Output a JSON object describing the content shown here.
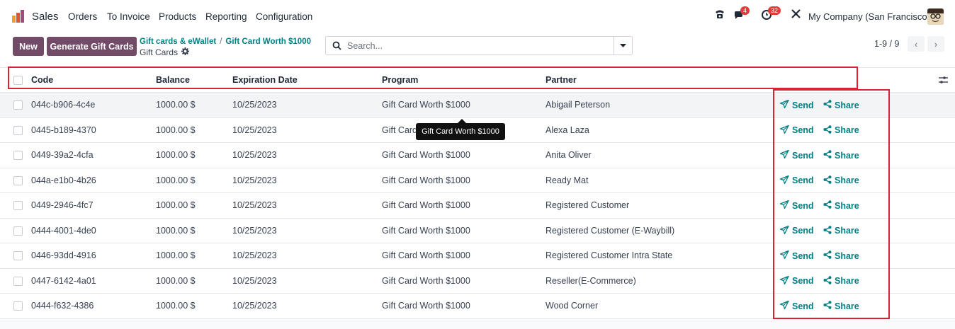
{
  "app": {
    "name": "Sales"
  },
  "menu": [
    "Orders",
    "To Invoice",
    "Products",
    "Reporting",
    "Configuration"
  ],
  "systray": {
    "messages_count": "4",
    "activities_count": "32",
    "company": "My Company (San Francisco)"
  },
  "toolbar": {
    "new_label": "New",
    "generate_label": "Generate Gift Cards"
  },
  "breadcrumb": {
    "parent": "Gift cards & eWallet",
    "separator": "/",
    "program": "Gift Card Worth $1000",
    "current": "Gift Cards"
  },
  "search": {
    "placeholder": "Search..."
  },
  "pager": {
    "text": "1-9 / 9"
  },
  "table": {
    "headers": {
      "code": "Code",
      "balance": "Balance",
      "expiration": "Expiration Date",
      "program": "Program",
      "partner": "Partner"
    },
    "rows": [
      {
        "code": "044c-b906-4c4e",
        "balance": "1000.00 $",
        "expiration": "10/25/2023",
        "program": "Gift Card Worth $1000",
        "partner": "Abigail Peterson"
      },
      {
        "code": "0445-b189-4370",
        "balance": "1000.00 $",
        "expiration": "10/25/2023",
        "program": "Gift Card",
        "partner": "Alexa Laza"
      },
      {
        "code": "0449-39a2-4cfa",
        "balance": "1000.00 $",
        "expiration": "10/25/2023",
        "program": "Gift Card Worth $1000",
        "partner": "Anita Oliver"
      },
      {
        "code": "044a-e1b0-4b26",
        "balance": "1000.00 $",
        "expiration": "10/25/2023",
        "program": "Gift Card Worth $1000",
        "partner": "Ready Mat"
      },
      {
        "code": "0449-2946-4fc7",
        "balance": "1000.00 $",
        "expiration": "10/25/2023",
        "program": "Gift Card Worth $1000",
        "partner": "Registered Customer"
      },
      {
        "code": "0444-4001-4de0",
        "balance": "1000.00 $",
        "expiration": "10/25/2023",
        "program": "Gift Card Worth $1000",
        "partner": "Registered Customer (E-Waybill)"
      },
      {
        "code": "0446-93dd-4916",
        "balance": "1000.00 $",
        "expiration": "10/25/2023",
        "program": "Gift Card Worth $1000",
        "partner": "Registered Customer Intra State"
      },
      {
        "code": "0447-6142-4a01",
        "balance": "1000.00 $",
        "expiration": "10/25/2023",
        "program": "Gift Card Worth $1000",
        "partner": "Reseller(E-Commerce)"
      },
      {
        "code": "0444-f632-4386",
        "balance": "1000.00 $",
        "expiration": "10/25/2023",
        "program": "Gift Card Worth $1000",
        "partner": "Wood Corner"
      }
    ],
    "send_label": "Send",
    "share_label": "Share"
  },
  "tooltip": {
    "text": "Gift Card Worth $1000"
  },
  "colors": {
    "primary": "#714b67",
    "link": "#017e84",
    "highlight": "#d9232e",
    "badge": "#e23b3b"
  }
}
